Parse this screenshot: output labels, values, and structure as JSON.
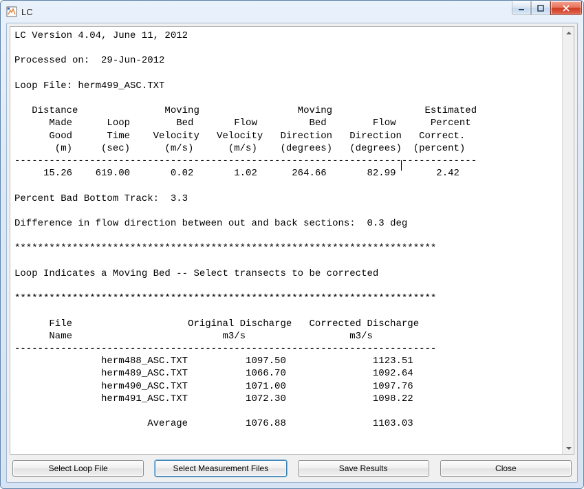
{
  "window": {
    "title": "LC"
  },
  "buttons": {
    "select_loop": "Select Loop File",
    "select_meas": "Select Measurement Files",
    "save": "Save Results",
    "close": "Close"
  },
  "report": {
    "version_line": "LC Version 4.04, June 11, 2012",
    "processed_label": "Processed on:",
    "processed_date": "29-Jun-2012",
    "loop_file_label": "Loop File:",
    "loop_file": "herm499_ASC.TXT",
    "headers": {
      "l1": "   Distance               Moving                 Moving                Estimated",
      "l2": "      Made      Loop        Bed       Flow         Bed        Flow      Percent",
      "l3": "      Good      Time    Velocity   Velocity   Direction   Direction   Correct.",
      "l4": "       (m)     (sec)      (m/s)      (m/s)    (degrees)   (degrees)  (percent)"
    },
    "dash1": "--------------------------------------------------------------------------------",
    "row": {
      "dist": "15.26",
      "time": "619.00",
      "mbv": "0.02",
      "fv": "1.02",
      "mbd": "264.66",
      "fd": "82.99",
      "epc": "2.42"
    },
    "pct_bad_label": "Percent Bad Bottom Track:",
    "pct_bad": "3.3",
    "diff_line_prefix": "Difference in flow direction between out and back sections:",
    "diff_val": "0.3 deg",
    "stars": "*************************************************************************",
    "moving_bed_line": "Loop Indicates a Moving Bed -- Select transects to be corrected",
    "table2_hdr1": "      File                    Original Discharge   Corrected Discharge",
    "table2_hdr2": "      Name                          m3/s                  m3/s",
    "dash2": "-------------------------------------------------------------------------",
    "files": [
      {
        "name": "herm488_ASC.TXT",
        "orig": "1097.50",
        "corr": "1123.51"
      },
      {
        "name": "herm489_ASC.TXT",
        "orig": "1066.70",
        "corr": "1092.64"
      },
      {
        "name": "herm490_ASC.TXT",
        "orig": "1071.00",
        "corr": "1097.76"
      },
      {
        "name": "herm491_ASC.TXT",
        "orig": "1072.30",
        "corr": "1098.22"
      }
    ],
    "avg_label": "Average",
    "avg_orig": "1076.88",
    "avg_corr": "1103.03"
  }
}
